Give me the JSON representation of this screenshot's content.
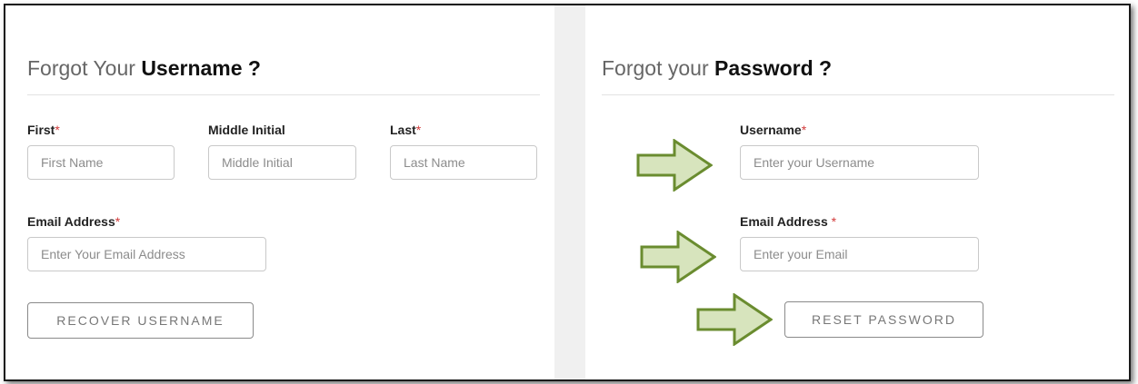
{
  "username_panel": {
    "title_prefix": "Forgot Your ",
    "title_bold": "Username ?",
    "first": {
      "label": "First",
      "required_mark": "*",
      "placeholder": "First Name"
    },
    "middle": {
      "label": "Middle Initial",
      "placeholder": "Middle Initial"
    },
    "last": {
      "label": "Last",
      "required_mark": "*",
      "placeholder": "Last Name"
    },
    "email": {
      "label": "Email Address",
      "required_mark": "*",
      "placeholder": "Enter Your Email Address"
    },
    "button_label": "RECOVER USERNAME"
  },
  "password_panel": {
    "title_prefix": "Forgot your ",
    "title_bold": "Password ?",
    "username": {
      "label": "Username",
      "required_mark": "*",
      "placeholder": "Enter your Username"
    },
    "email": {
      "label": "Email Address ",
      "required_mark": "*",
      "placeholder": "Enter your Email"
    },
    "button_label": "RESET PASSWORD"
  },
  "annotation": {
    "arrow_fill": "#d7e4bd",
    "arrow_stroke": "#6a8c2f"
  },
  "colors": {
    "required": "#d23b3b",
    "gutter": "#f0f0f0"
  }
}
